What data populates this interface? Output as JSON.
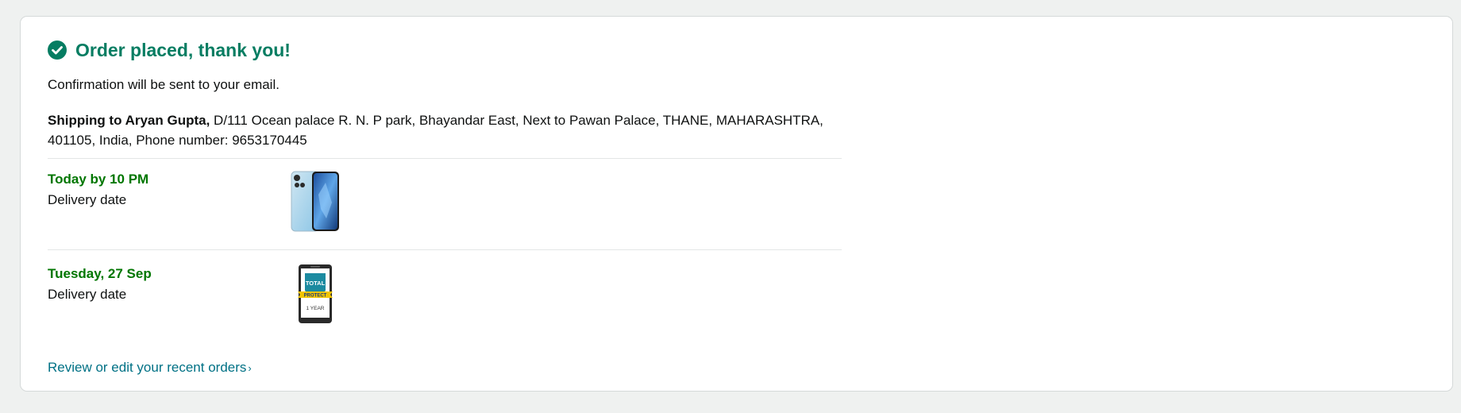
{
  "header": {
    "title": "Order placed, thank you!",
    "icon": "check-circle-icon",
    "accent_color": "#067d62"
  },
  "confirmation_text": "Confirmation will be sent to your email.",
  "shipping": {
    "prefix": "Shipping to Aryan Gupta,",
    "address": "D/111 Ocean palace R. N. P park, Bhayandar East, Next to Pawan Palace, THANE, MAHARASHTRA, 401105, India, Phone number: 9653170445"
  },
  "deliveries": [
    {
      "when": "Today by 10 PM",
      "label": "Delivery date",
      "product_icon": "smartphone-product-image"
    },
    {
      "when": "Tuesday, 27 Sep",
      "label": "Delivery date",
      "product_icon": "total-protect-plan-image",
      "badge_top": "TOTAL",
      "badge_ribbon": "PROTECT",
      "badge_bottom": "1 YEAR"
    }
  ],
  "review_link": {
    "label": "Review or edit your recent orders",
    "chevron": "›"
  },
  "colors": {
    "delivery_green": "#007600",
    "link_teal": "#007185"
  }
}
